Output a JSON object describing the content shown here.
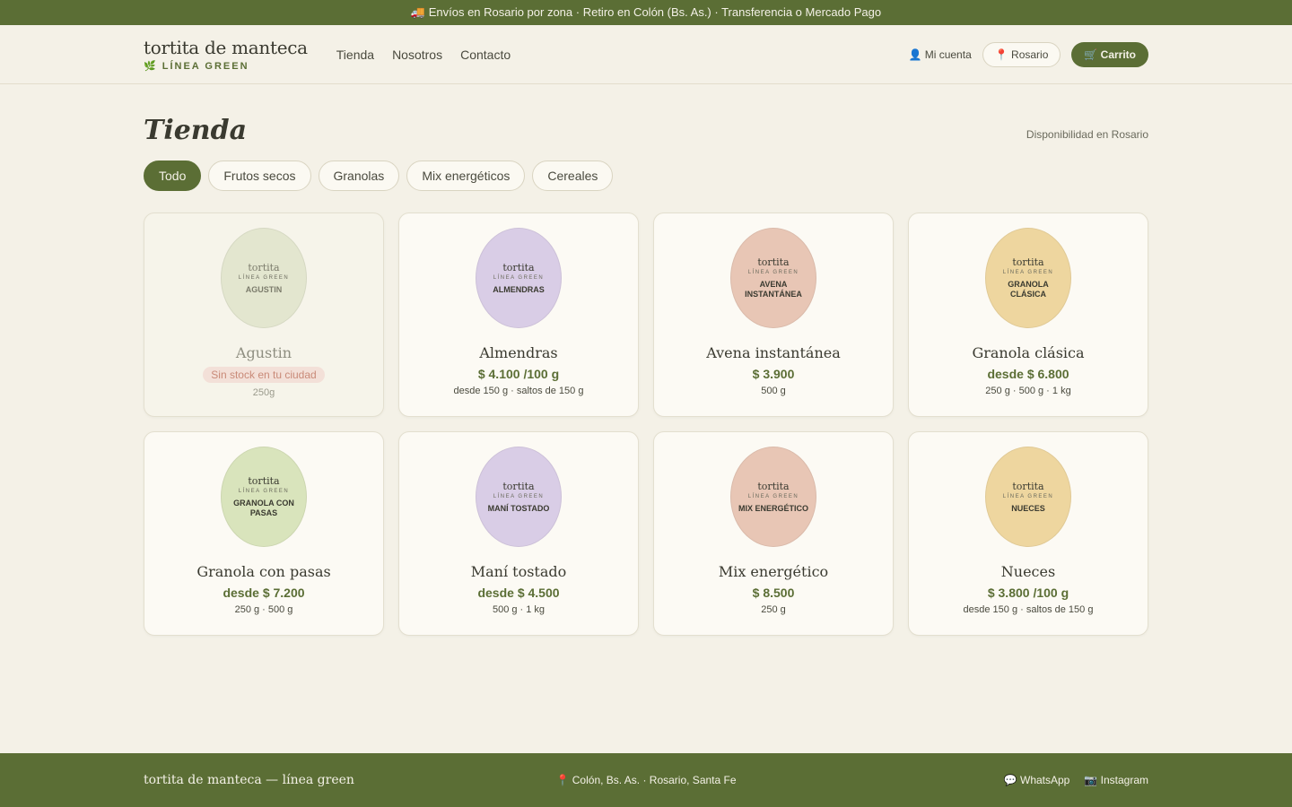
{
  "topbar": {
    "text": "🚚 Envíos en Rosario por zona · Retiro en Colón (Bs. As.) · Transferencia o Mercado Pago"
  },
  "header": {
    "brand_name": "tortita de manteca",
    "brand_sub": "🌿 LÍNEA GREEN",
    "nav": [
      "Tienda",
      "Nosotros",
      "Contacto"
    ],
    "account": "👤 Mi cuenta",
    "location": "📍 Rosario",
    "cart": "🛒 Carrito"
  },
  "main": {
    "title": "Tienda",
    "availability": "Disponibilidad en Rosario",
    "filters": [
      "Todo",
      "Frutos secos",
      "Granolas",
      "Mix energéticos",
      "Cereales"
    ],
    "active_filter": "Todo"
  },
  "products": [
    {
      "name": "Agustin",
      "oval_brand": "tortita",
      "oval_line": "LÍNEA GREEN",
      "oval_name": "AGUSTIN",
      "color": "#e3e6cf",
      "stock": "Sin stock en tu ciudad",
      "price": "",
      "note": "250g",
      "out": true
    },
    {
      "name": "Almendras",
      "oval_brand": "tortita",
      "oval_line": "LÍNEA GREEN",
      "oval_name": "ALMENDRAS",
      "color": "#d9cde6",
      "price": "$ 4.100 /100 g",
      "note": "desde 150 g · saltos de 150 g"
    },
    {
      "name": "Avena instantánea",
      "oval_brand": "tortita",
      "oval_line": "LÍNEA GREEN",
      "oval_name": "AVENA INSTANTÁNEA",
      "color": "#e8c6b5",
      "price": "$ 3.900",
      "note": "500 g"
    },
    {
      "name": "Granola clásica",
      "oval_brand": "tortita",
      "oval_line": "LÍNEA GREEN",
      "oval_name": "GRANOLA CLÁSICA",
      "color": "#eed69f",
      "price": "desde $ 6.800",
      "note": "250 g · 500 g · 1 kg"
    },
    {
      "name": "Granola con pasas",
      "oval_brand": "tortita",
      "oval_line": "LÍNEA GREEN",
      "oval_name": "GRANOLA CON PASAS",
      "color": "#d9e4bc",
      "price": "desde $ 7.200",
      "note": "250 g · 500 g"
    },
    {
      "name": "Maní tostado",
      "oval_brand": "tortita",
      "oval_line": "LÍNEA GREEN",
      "oval_name": "MANÍ TOSTADO",
      "color": "#d9cde6",
      "price": "desde $ 4.500",
      "note": "500 g · 1 kg"
    },
    {
      "name": "Mix energético",
      "oval_brand": "tortita",
      "oval_line": "LÍNEA GREEN",
      "oval_name": "MIX ENERGÉTICO",
      "color": "#e8c6b5",
      "price": "$ 8.500",
      "note": "250 g"
    },
    {
      "name": "Nueces",
      "oval_brand": "tortita",
      "oval_line": "LÍNEA GREEN",
      "oval_name": "NUECES",
      "color": "#eed69f",
      "price": "$ 3.800 /100 g",
      "note": "desde 150 g · saltos de 150 g"
    }
  ],
  "footer": {
    "brand": "tortita de manteca — línea green",
    "location": "📍 Colón, Bs. As. · Rosario, Santa Fe",
    "whatsapp": "💬 WhatsApp",
    "instagram": "📷 Instagram"
  },
  "colors": {
    "brand_green": "#5b6e35",
    "background": "#f4f1e7"
  }
}
